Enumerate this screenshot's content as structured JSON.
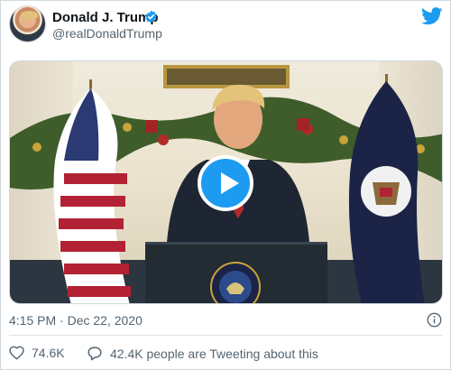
{
  "author": {
    "display_name": "Donald J. Trump",
    "handle": "@realDonaldTrump",
    "verified": true,
    "avatar_icon": "avatar-photo"
  },
  "brand": {
    "icon": "twitter-bird-icon",
    "color": "#1d9bf0"
  },
  "media": {
    "type": "video",
    "play_icon": "play-icon"
  },
  "meta": {
    "timestamp": "4:15 PM · Dec 22, 2020",
    "info_icon": "info-icon"
  },
  "actions": {
    "like_count": "74.6K",
    "tweeting_text": "42.4K people are Tweeting about this"
  },
  "colors": {
    "accent": "#1d9bf0",
    "secondary_text": "#536471",
    "primary_text": "#0f1419"
  }
}
